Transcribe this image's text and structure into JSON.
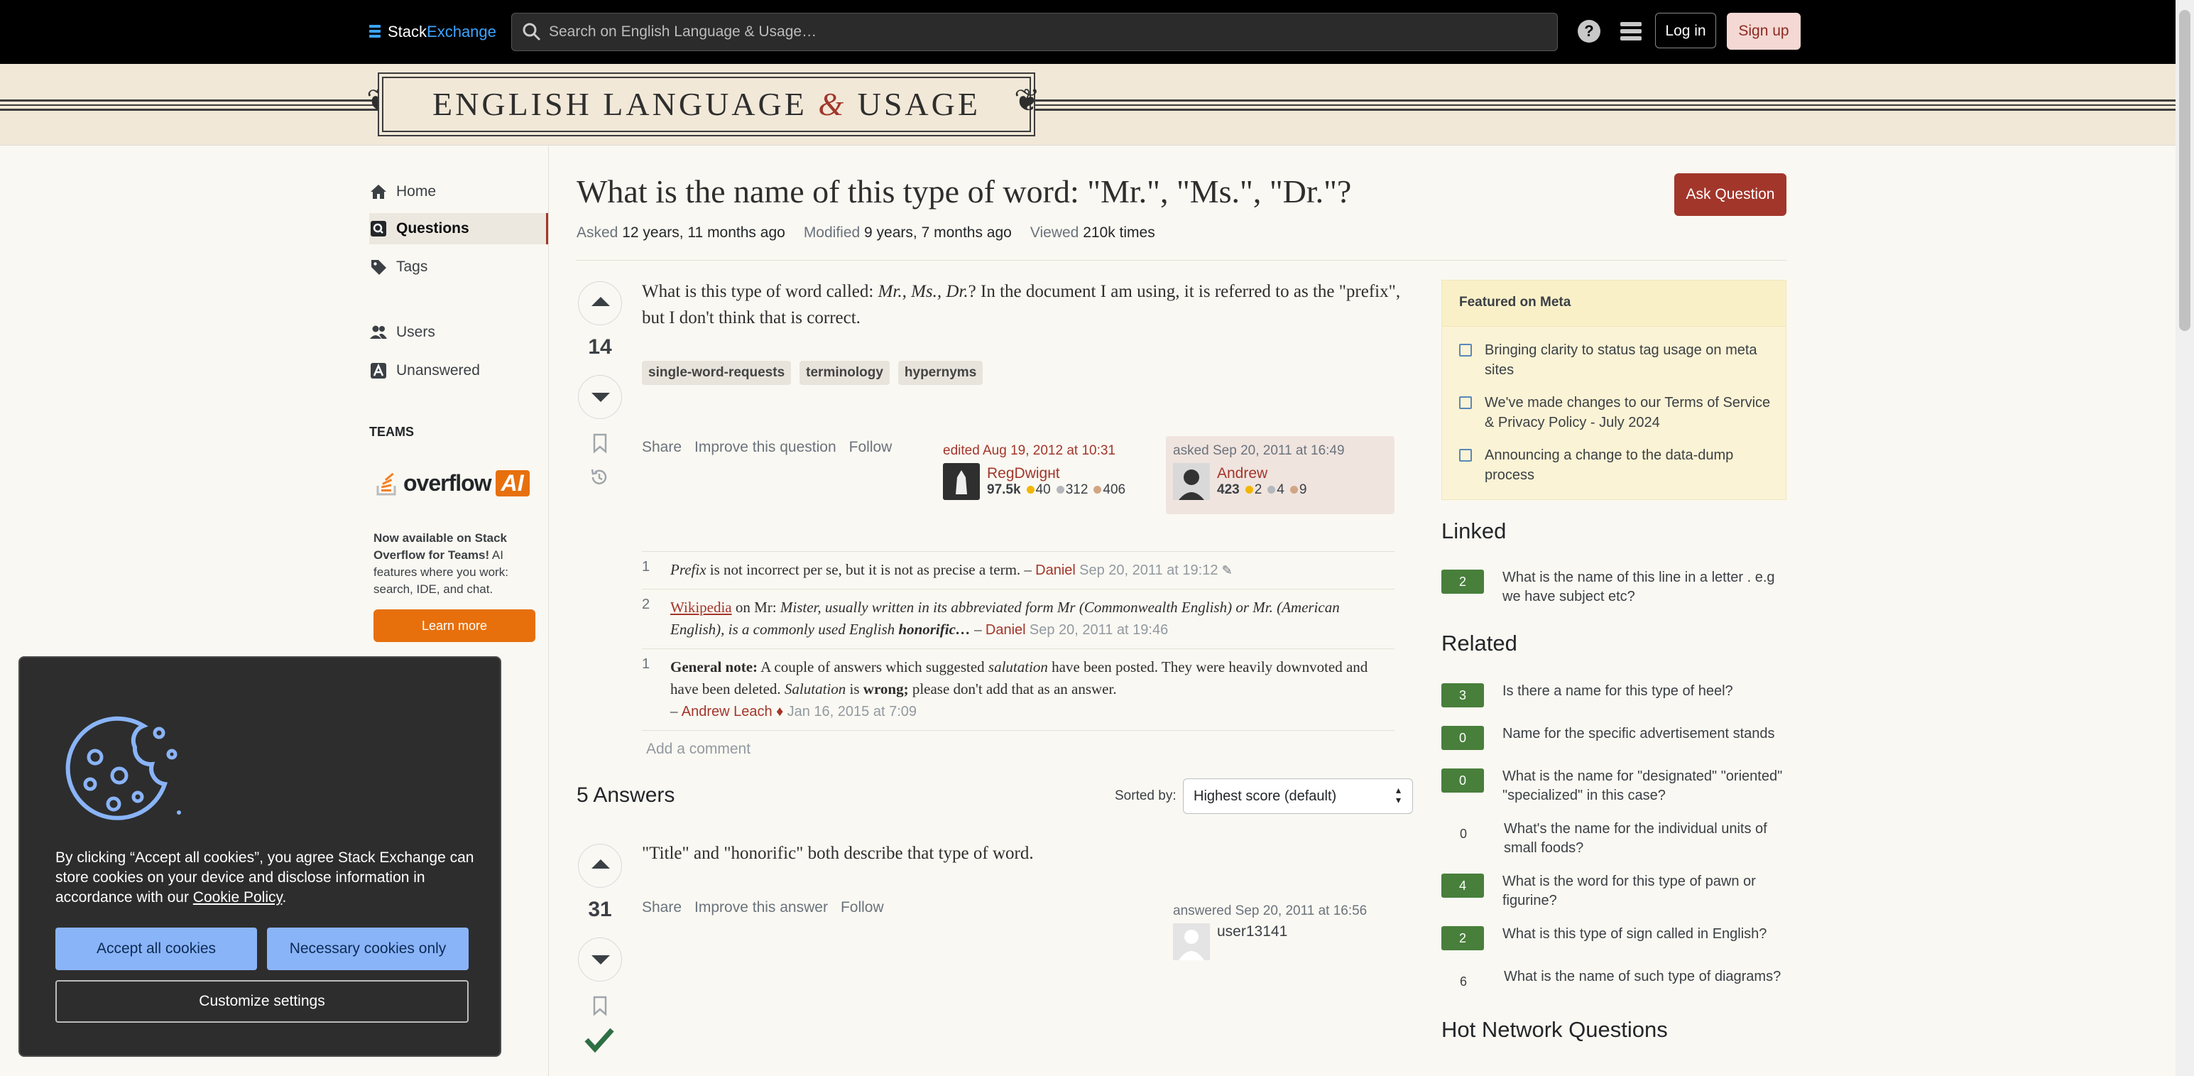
{
  "topbar": {
    "logo_stack": "Stack",
    "logo_exchange": "Exchange",
    "search_placeholder": "Search on English Language & Usage…",
    "login": "Log in",
    "signup": "Sign up"
  },
  "site": {
    "title_left": "ENGLISH LANGUAGE",
    "title_amp": "&",
    "title_right": "USAGE"
  },
  "nav": {
    "home": "Home",
    "questions": "Questions",
    "tags": "Tags",
    "users": "Users",
    "unanswered": "Unanswered",
    "teams_label": "TEAMS",
    "teams_brand": "overflow",
    "teams_ai": "AI",
    "teams_copy_bold": "Now available on Stack Overflow for Teams!",
    "teams_copy_rest": " AI features where you work: search, IDE, and chat.",
    "learn_more": "Learn more"
  },
  "question": {
    "title": "What is the name of this type of word: \"Mr.\", \"Ms.\", \"Dr.\"?",
    "ask_button": "Ask Question",
    "asked_label": "Asked",
    "asked_value": "12 years, 11 months ago",
    "modified_label": "Modified",
    "modified_value": "9 years, 7 months ago",
    "viewed_label": "Viewed",
    "viewed_value": "210k times",
    "votes": "14",
    "body_1": "What is this type of word called: ",
    "body_em": "Mr., Ms., Dr.",
    "body_2": "? In the document I am using, it is referred to as the \"prefix\", but I don't think that is correct.",
    "tags": [
      "single-word-requests",
      "terminology",
      "hypernyms"
    ],
    "menu": [
      "Share",
      "Improve this question",
      "Follow"
    ],
    "edited": {
      "label": "edited Aug 19, 2012 at 10:31",
      "user": "RegDwigнt",
      "rep": "97.5k",
      "gold": "40",
      "silver": "312",
      "bronze": "406"
    },
    "asked": {
      "label": "asked Sep 20, 2011 at 16:49",
      "user": "Andrew",
      "rep": "423",
      "gold": "2",
      "silver": "4",
      "bronze": "9"
    }
  },
  "comments": [
    {
      "score": "1",
      "em": "Prefix",
      "text": " is not incorrect per se, but it is not as precise a term. – ",
      "user": "Daniel",
      "date": "Sep 20, 2011 at 19:12"
    },
    {
      "score": "2",
      "link": "Wikipedia",
      "text_a": " on Mr: ",
      "em": "Mister, usually written in its abbreviated form Mr (Commonwealth English) or Mr. (American English), is a commonly used English ",
      "strong": "honorific…",
      "dash": " – ",
      "user": "Daniel",
      "date": "Sep 20, 2011 at 19:46"
    },
    {
      "score": "1",
      "strong": "General note:",
      "text_a": " A couple of answers which suggested ",
      "em_a": "salutation",
      "text_b": " have been posted. They were heavily downvoted and have been deleted. ",
      "em_b": "Salutation",
      "text_c": " is ",
      "strong_b": "wrong;",
      "text_d": " please don't add that as an answer.",
      "dash": "– ",
      "user": "Andrew Leach ♦",
      "date": "Jan 16, 2015 at 7:09"
    }
  ],
  "add_comment": "Add a comment",
  "answers": {
    "heading": "5 Answers",
    "sorted_by": "Sorted by:",
    "sort_value": "Highest score (default)",
    "first": {
      "votes": "31",
      "body": "\"Title\" and \"honorific\" both describe that type of word.",
      "menu": [
        "Share",
        "Improve this answer",
        "Follow"
      ],
      "answered": "answered Sep 20, 2011 at 16:56",
      "user": "user13141"
    }
  },
  "sidebar": {
    "featured_heading": "Featured on Meta",
    "featured": [
      "Bringing clarity to status tag usage on meta sites",
      "We've made changes to our Terms of Service & Privacy Policy - July 2024",
      "Announcing a change to the data-dump process"
    ],
    "linked_heading": "Linked",
    "linked": [
      {
        "count": "2",
        "text": "What is the name of this line in a letter . e.g we have subject etc?"
      }
    ],
    "related_heading": "Related",
    "related": [
      {
        "count": "3",
        "text": "Is there a name for this type of heel?"
      },
      {
        "count": "0",
        "text": "Name for the specific advertisement stands"
      },
      {
        "count": "0",
        "text": "What is the name for \"designated\" \"oriented\" \"specialized\" in this case?"
      },
      {
        "count": "0",
        "text": "What's the name for the individual units of small foods?"
      },
      {
        "count": "4",
        "text": "What is the word for this type of pawn or figurine?"
      },
      {
        "count": "2",
        "text": "What is this type of sign called in English?"
      },
      {
        "count": "6",
        "text": "What is the name of such type of diagrams?"
      }
    ],
    "hot_heading": "Hot Network Questions"
  },
  "cookie": {
    "text_a": "By clicking “Accept all cookies”, you agree Stack Exchange can store cookies on your device and disclose information in accordance with our ",
    "policy": "Cookie Policy",
    "text_b": ".",
    "accept": "Accept all cookies",
    "necessary": "Necessary cookies only",
    "customize": "Customize settings"
  },
  "colors": {
    "accent": "#a2362b",
    "answered_count": "#487f3b",
    "cookie_button": "#8ab4f8"
  }
}
